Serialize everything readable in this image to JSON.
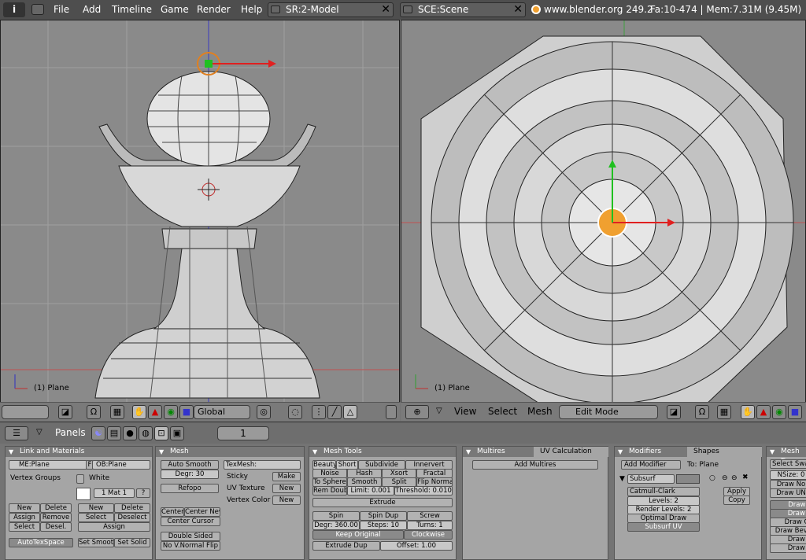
{
  "topbar": {
    "info_icon": "i",
    "menus": [
      "File",
      "Add",
      "Timeline",
      "Game",
      "Render",
      "Help"
    ],
    "screen_field": "SR:2-Model",
    "scene_field": "SCE:Scene",
    "site": "www.blender.org 249.2",
    "stats": "Fa:10-474 | Mem:7.31M (9.45M)"
  },
  "left_view": {
    "object_label": "(1) Plane",
    "orientation": "Global"
  },
  "right_view": {
    "object_label": "(1) Plane",
    "menus": [
      "View",
      "Select",
      "Mesh"
    ],
    "mode": "Edit Mode"
  },
  "buttons_header": {
    "panels_label": "Panels",
    "frame": "1"
  },
  "link_materials": {
    "title": "Link and Materials",
    "me": "ME:Plane",
    "f": "F",
    "ob": "OB:Plane",
    "vertex_groups": "Vertex Groups",
    "white": "White",
    "mat": "1 Mat 1",
    "q": "?",
    "left_btns": [
      "New",
      "Delete",
      "Assign",
      "Remove",
      "Select",
      "Desel."
    ],
    "right_btns": [
      "New",
      "Delete",
      "Select",
      "Deselect",
      "Assign"
    ],
    "autotex": "AutoTexSpace",
    "set_smooth": "Set Smoot",
    "set_solid": "Set Solid"
  },
  "mesh": {
    "title": "Mesh",
    "auto_smooth": "Auto Smooth",
    "degr": "Degr: 30",
    "refopo": "Refopo",
    "center": "Center",
    "center_new": "Center New",
    "center_cursor": "Center Cursor",
    "double_sided": "Double Sided",
    "no_vnormal": "No V.Normal Flip",
    "texmesh": "TexMesh:",
    "sticky": "Sticky",
    "make": "Make",
    "uv_texture": "UV Texture",
    "new1": "New",
    "vertex_color": "Vertex Color",
    "new2": "New"
  },
  "mesh_tools": {
    "title": "Mesh Tools",
    "row1": [
      "Beauty",
      "Short",
      "Subdivide",
      "Innervert"
    ],
    "row2": [
      "Noise",
      "Hash",
      "Xsort",
      "Fractal"
    ],
    "row3": [
      "To Sphere",
      "Smooth",
      "Split",
      "Flip Normal"
    ],
    "rem_doubl": "Rem Doubl",
    "limit": "Limit: 0.001",
    "threshold": "Threshold: 0.010",
    "extrude": "Extrude",
    "spin": "Spin",
    "spin_dup": "Spin Dup",
    "screw": "Screw",
    "degr": "Degr: 360.00",
    "steps": "Steps: 10",
    "turns": "Turns: 1",
    "keep_original": "Keep Original",
    "clockwise": "Clockwise",
    "extrude_dup": "Extrude Dup",
    "offset": "Offset: 1.00"
  },
  "multires": {
    "tab1": "Multires",
    "tab2": "UV Calculation",
    "add": "Add Multires"
  },
  "modifiers": {
    "tab1": "Modifiers",
    "tab2": "Shapes",
    "add": "Add Modifier",
    "to": "To: Plane",
    "name": "Subsurf",
    "type": "Catmull-Clark",
    "levels": "Levels: 2",
    "render_levels": "Render Levels: 2",
    "optimal": "Optimal Draw",
    "subsurf_uv": "Subsurf UV",
    "apply": "Apply",
    "copy": "Copy"
  },
  "mesh_tools_more": {
    "title": "Mesh Too",
    "select_swap": "Select Swa",
    "nsize": "NSize: 0",
    "draw_no": "Draw No",
    "draw_un": "Draw UN",
    "items": [
      "Draw F",
      "Draw E",
      "Draw Cr",
      "Draw Beve",
      "Draw S",
      "Draw S"
    ]
  },
  "colors": {
    "accent": "#f0a030",
    "background": "#747474",
    "viewport": "#8a8a8a"
  }
}
